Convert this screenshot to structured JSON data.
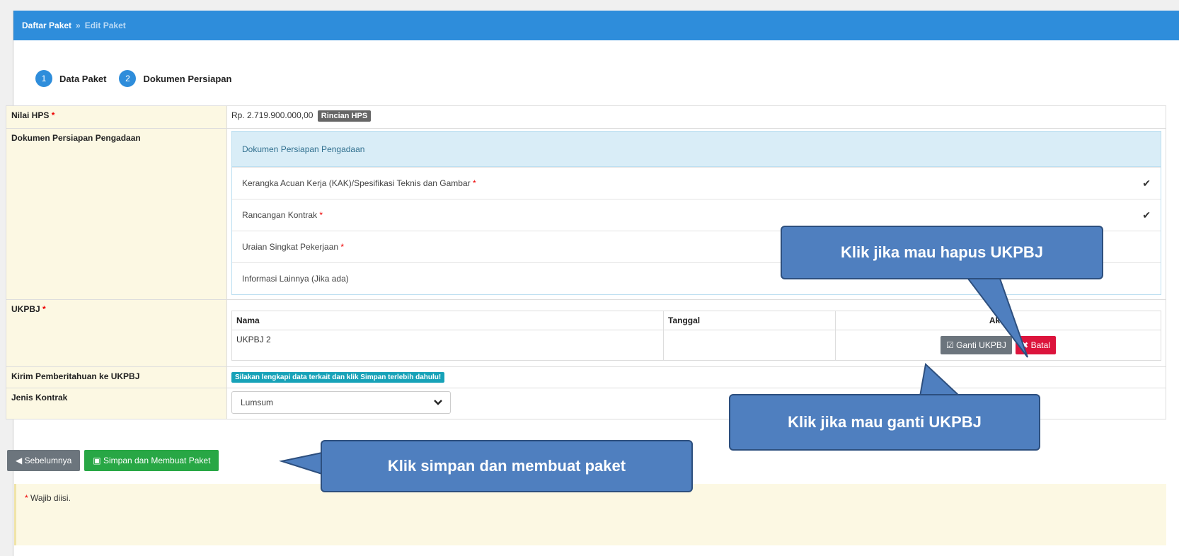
{
  "breadcrumb": {
    "root": "Daftar Paket",
    "separator": "»",
    "current": "Edit Paket"
  },
  "steps": [
    {
      "number": "1",
      "label": "Data Paket"
    },
    {
      "number": "2",
      "label": "Dokumen Persiapan"
    }
  ],
  "form": {
    "nilai_hps": {
      "label": "Nilai HPS",
      "value": "Rp. 2.719.900.000,00",
      "badge": "Rincian HPS"
    },
    "dokumen": {
      "label": "Dokumen Persiapan Pengadaan",
      "panel_title": "Dokumen Persiapan Pengadaan",
      "items": [
        {
          "label": "Kerangka Acuan Kerja (KAK)/Spesifikasi Teknis dan Gambar",
          "required": true,
          "check": "✔"
        },
        {
          "label": "Rancangan Kontrak",
          "required": true,
          "check": "✔"
        },
        {
          "label": "Uraian Singkat Pekerjaan",
          "required": true,
          "check": ""
        },
        {
          "label": "Informasi Lainnya (Jika ada)",
          "required": false,
          "check": ""
        }
      ]
    },
    "ukpbj": {
      "label": "UKPBJ",
      "columns": [
        "Nama",
        "Tanggal",
        "Aksi"
      ],
      "row": {
        "nama": "UKPBJ 2",
        "tanggal": ""
      },
      "ganti_label": "Ganti UKPBJ",
      "batal_label": "Batal"
    },
    "kirim": {
      "label": "Kirim Pemberitahuan ke UKPBJ",
      "badge": "Silakan lengkapi data terkait dan klik Simpan terlebih dahulu!"
    },
    "jenis_kontrak": {
      "label": "Jenis Kontrak",
      "selected": "Lumsum"
    }
  },
  "buttons": {
    "sebelumnya": "Sebelumnya",
    "simpan": "Simpan dan Membuat Paket"
  },
  "note": "Wajib diisi.",
  "required_mark": "*",
  "callouts": {
    "hapus": "Klik jika mau hapus UKPBJ",
    "ganti": "Klik jika mau ganti UKPBJ",
    "simpan": "Klik simpan dan membuat paket"
  },
  "colors": {
    "header": "#2e8ddb",
    "label_bg": "#fcf8e3",
    "callout": "#4f7fbf",
    "danger": "#dc143c",
    "success": "#28a745"
  }
}
